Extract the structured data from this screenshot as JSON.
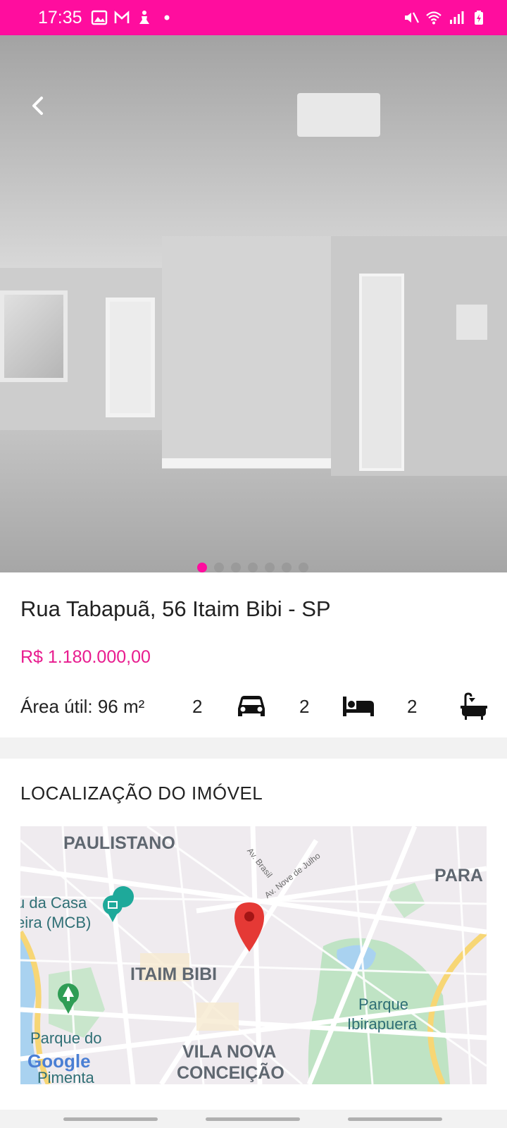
{
  "status_bar": {
    "time": "17:35",
    "left_icons": [
      "image-icon",
      "gmail-icon",
      "accessibility-icon",
      "dot-icon"
    ],
    "right_icons": [
      "mute-icon",
      "wifi-icon",
      "signal-icon",
      "battery-icon"
    ]
  },
  "gallery": {
    "photo_count": 7,
    "active_index": 0
  },
  "property": {
    "address": "Rua Tabapuã, 56 Itaim Bibi - SP",
    "price": "R$ 1.180.000,00",
    "area_label": "Área útil: 96 m²",
    "parking_count": "2",
    "bedrooms_count": "2",
    "bathrooms_count": "2"
  },
  "location": {
    "section_title": "LOCALIZAÇÃO DO IMÓVEL",
    "map": {
      "labels": [
        "PAULISTANO",
        "ITAIM BIBI",
        "VILA NOVA",
        "CONCEIÇÃO",
        "PARA"
      ],
      "places": [
        "u da Casa",
        "eira (MCB)",
        "Parque",
        "Ibirapuera",
        "Parque do",
        "Pimenta"
      ],
      "streets": [
        "Av. Brasil",
        "Av. Nove de Julho"
      ],
      "attribution": "Google"
    }
  },
  "colors": {
    "accent": "#ff0d9e",
    "price": "#e81c8f",
    "text": "#222222"
  }
}
